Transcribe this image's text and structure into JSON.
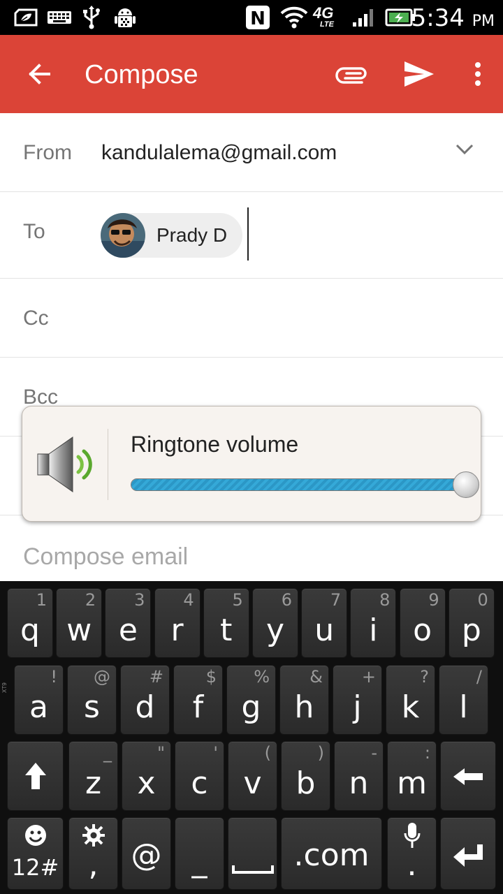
{
  "status_bar": {
    "time": "5:34",
    "ampm": "PM",
    "network_label": "4G",
    "network_sub": "LTE",
    "nfc_label": "N",
    "icons": [
      "leaf-icon",
      "keyboard-icon",
      "usb-icon",
      "android-debug-icon",
      "nfc-icon",
      "wifi-icon",
      "4g-lte-icon",
      "signal-icon",
      "battery-charging-icon"
    ]
  },
  "app_bar": {
    "title": "Compose",
    "color": "#db4437",
    "icons": [
      "back-arrow-icon",
      "attach-icon",
      "send-icon",
      "overflow-menu-icon"
    ]
  },
  "form": {
    "from_label": "From",
    "from_value": "kandulalema@gmail.com",
    "to_label": "To",
    "to_chip": "Prady D",
    "cc_label": "Cc",
    "bcc_label": "Bcc",
    "body_placeholder": "Compose email"
  },
  "volume": {
    "title": "Ringtone volume",
    "level": 1.0,
    "accent": "#35a9d8"
  },
  "keyboard": {
    "tag": "XT9",
    "row1": [
      {
        "main": "q",
        "sub": "1"
      },
      {
        "main": "w",
        "sub": "2"
      },
      {
        "main": "e",
        "sub": "3"
      },
      {
        "main": "r",
        "sub": "4"
      },
      {
        "main": "t",
        "sub": "5"
      },
      {
        "main": "y",
        "sub": "6"
      },
      {
        "main": "u",
        "sub": "7"
      },
      {
        "main": "i",
        "sub": "8"
      },
      {
        "main": "o",
        "sub": "9"
      },
      {
        "main": "p",
        "sub": "0"
      }
    ],
    "row2": [
      {
        "main": "a",
        "sub": "!"
      },
      {
        "main": "s",
        "sub": "@"
      },
      {
        "main": "d",
        "sub": "#"
      },
      {
        "main": "f",
        "sub": "$"
      },
      {
        "main": "g",
        "sub": "%"
      },
      {
        "main": "h",
        "sub": "&"
      },
      {
        "main": "j",
        "sub": "+"
      },
      {
        "main": "k",
        "sub": "?"
      },
      {
        "main": "l",
        "sub": "/"
      }
    ],
    "row3": [
      {
        "main": "z",
        "sub": "_"
      },
      {
        "main": "x",
        "sub": "\""
      },
      {
        "main": "c",
        "sub": "'"
      },
      {
        "main": "v",
        "sub": "("
      },
      {
        "main": "b",
        "sub": ")"
      },
      {
        "main": "n",
        "sub": "-"
      },
      {
        "main": "m",
        "sub": ":"
      }
    ],
    "row4": {
      "emoji_label": "12#",
      "comma": ",",
      "at": "@",
      "underscore": "_",
      "dotcom": ".com",
      "period": "."
    },
    "icons": [
      "shift-icon",
      "backspace-icon",
      "emoji-icon",
      "settings-gear-icon",
      "space-icon",
      "microphone-icon",
      "enter-icon"
    ]
  }
}
